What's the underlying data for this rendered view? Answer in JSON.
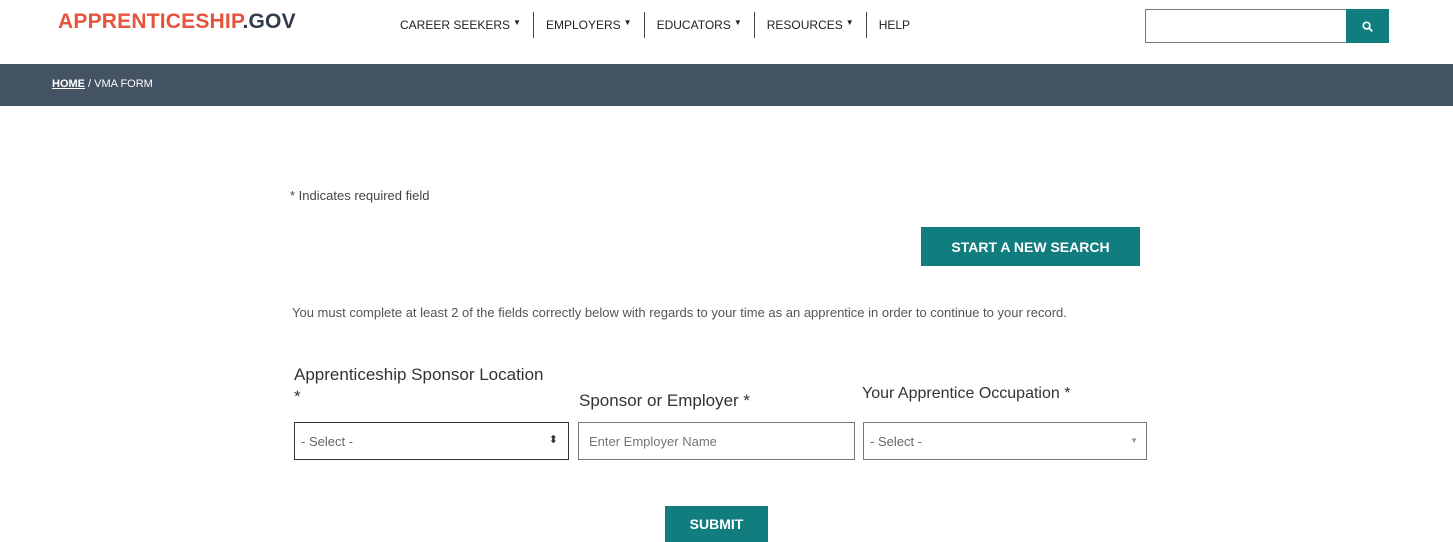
{
  "header": {
    "logo_primary": "APPRENTICESHIP",
    "logo_suffix": ".GOV",
    "nav": [
      {
        "label": "CAREER SEEKERS",
        "caret": "▼"
      },
      {
        "label": "EMPLOYERS",
        "caret": "▼"
      },
      {
        "label": "EDUCATORS",
        "caret": "▼"
      },
      {
        "label": "RESOURCES",
        "caret": "▼"
      },
      {
        "label": "HELP"
      }
    ],
    "search": {
      "placeholder": "",
      "icon": "search-icon"
    }
  },
  "breadcrumb": {
    "home": "HOME",
    "separator": " / ",
    "current": "VMA FORM"
  },
  "form": {
    "required_note": "* Indicates required field",
    "new_search_label": "START A NEW SEARCH",
    "instructions": "You must complete at least 2 of the fields correctly below with regards to your time as an apprentice in order to continue to your record.",
    "location_label": "Apprenticeship Sponsor Location *",
    "location_value": "- Select -",
    "employer_label": "Sponsor or Employer *",
    "employer_placeholder": "Enter Employer Name",
    "occupation_label": "Your Apprentice Occupation *",
    "occupation_value": "- Select -",
    "submit_label": "SUBMIT"
  },
  "colors": {
    "brand_red": "#e5533d",
    "brand_dark": "#333c4a",
    "teal": "#117d7f",
    "breadcrumb_bg": "#445363"
  }
}
